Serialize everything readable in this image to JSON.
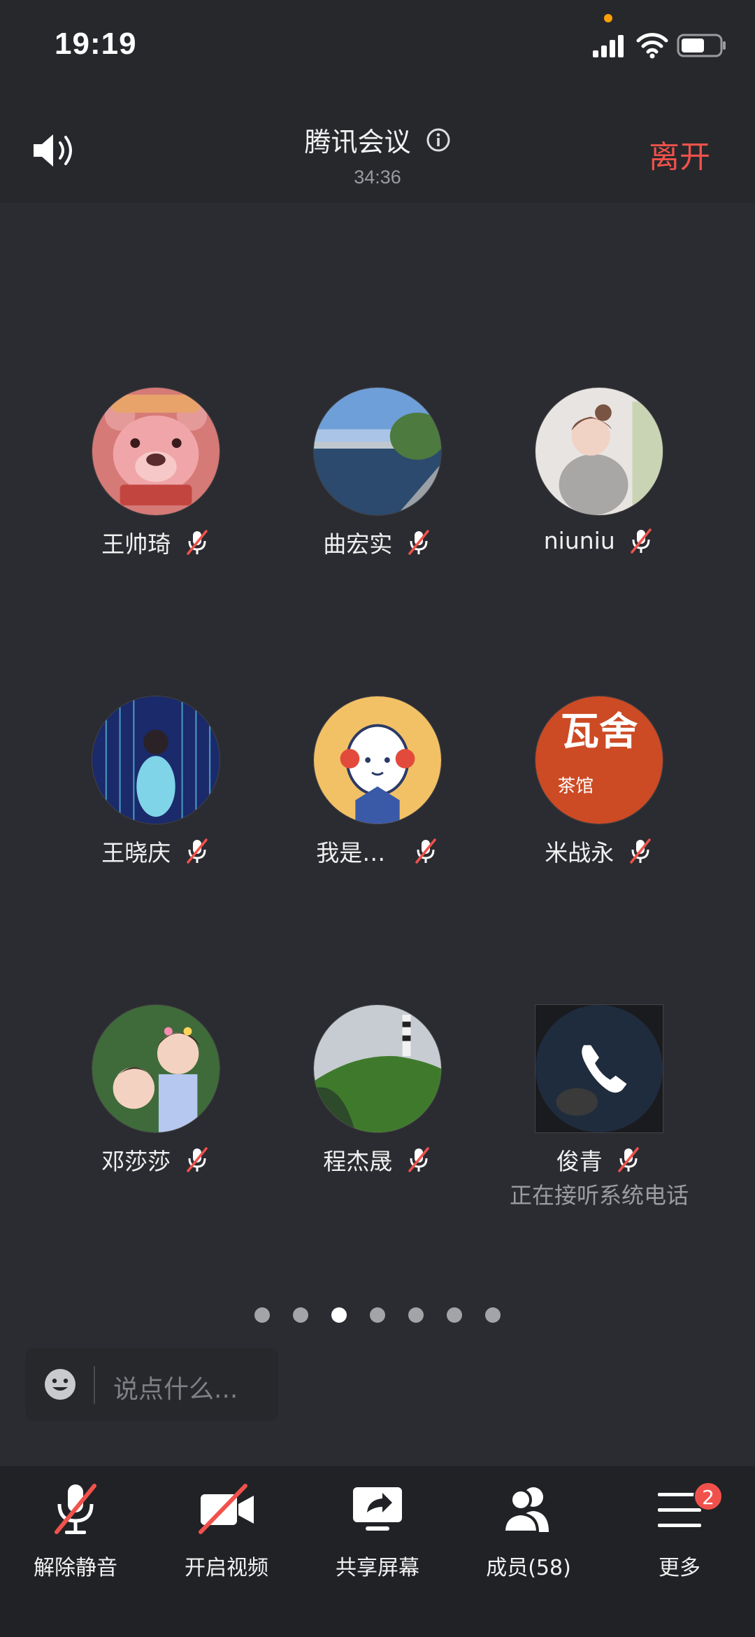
{
  "status_bar": {
    "time": "19:19"
  },
  "header": {
    "title": "腾讯会议",
    "duration": "34:36",
    "leave_label": "离开"
  },
  "participants": [
    {
      "name": "王帅琦",
      "muted": true,
      "avatar": "pink-bear"
    },
    {
      "name": "曲宏实",
      "muted": true,
      "avatar": "river-landscape"
    },
    {
      "name": "niuniu",
      "muted": true,
      "avatar": "girl-photo"
    },
    {
      "name": "王晓庆",
      "muted": true,
      "avatar": "light-tunnel-girl"
    },
    {
      "name": "我是…",
      "muted": true,
      "avatar": "cartoon-girl"
    },
    {
      "name": "米战永",
      "muted": true,
      "avatar": "wa-she-logo",
      "logo_text_top": "瓦舍",
      "logo_text_bottom": "茶馆"
    },
    {
      "name": "邓莎莎",
      "muted": true,
      "avatar": "two-girls-photo"
    },
    {
      "name": "程杰晟",
      "muted": true,
      "avatar": "lighthouse-hill"
    },
    {
      "name": "俊青",
      "muted": true,
      "avatar": "phone-call",
      "status": "正在接听系统电话"
    }
  ],
  "pagination": {
    "total": 7,
    "active_index": 2
  },
  "chat": {
    "placeholder": "说点什么..."
  },
  "toolbar": {
    "unmute_label": "解除静音",
    "video_label": "开启视频",
    "share_label": "共享屏幕",
    "members_label": "成员(58)",
    "more_label": "更多",
    "more_badge": "2"
  },
  "colors": {
    "background": "#2b2c31",
    "accent_red": "#f0524b",
    "header_bg": "#27282c",
    "toolbar_bg": "#212226"
  }
}
